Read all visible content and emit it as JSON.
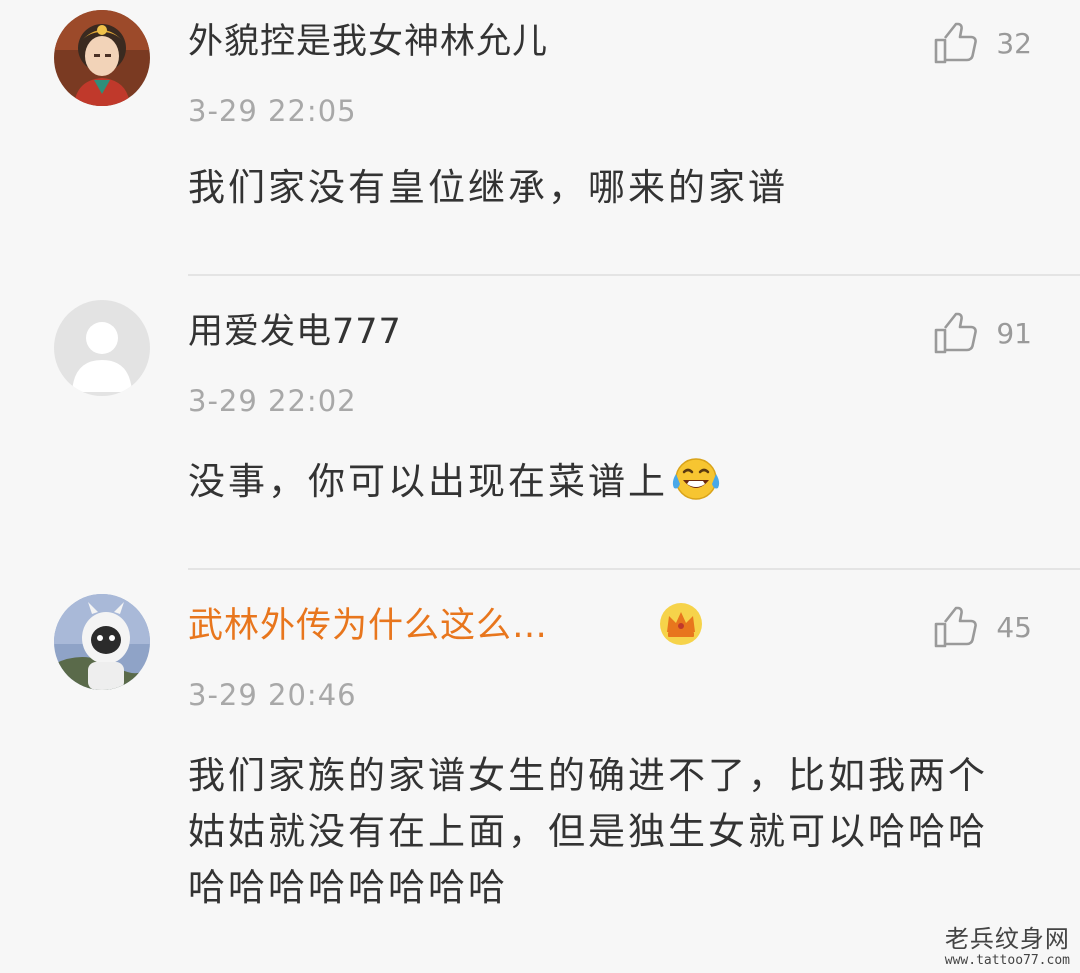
{
  "comments": [
    {
      "username": "外貌控是我女神林允儿",
      "time": "3-29 22:05",
      "likes": "32",
      "content": "我们家没有皇位继承，哪来的家谱",
      "avatar_icon": "anime-character-avatar"
    },
    {
      "username": "用爱发电777",
      "time": "3-29 22:02",
      "likes": "91",
      "content": "没事，你可以出现在菜谱上",
      "content_emoji": "laughing-tears-emoji",
      "avatar_icon": "default-user-avatar"
    },
    {
      "username": "武林外传为什么这么…",
      "username_color": "#e8761d",
      "vip_badge": "crown-icon",
      "time": "3-29 20:46",
      "likes": "45",
      "content": "我们家族的家谱女生的确进不了，比如我两个姑姑就没有在上面，但是独生女就可以哈哈哈哈哈哈哈哈哈哈哈",
      "avatar_icon": "astronaut-avatar"
    }
  ],
  "watermark": {
    "title": "老兵纹身网",
    "url": "www.tattoo77.com"
  }
}
